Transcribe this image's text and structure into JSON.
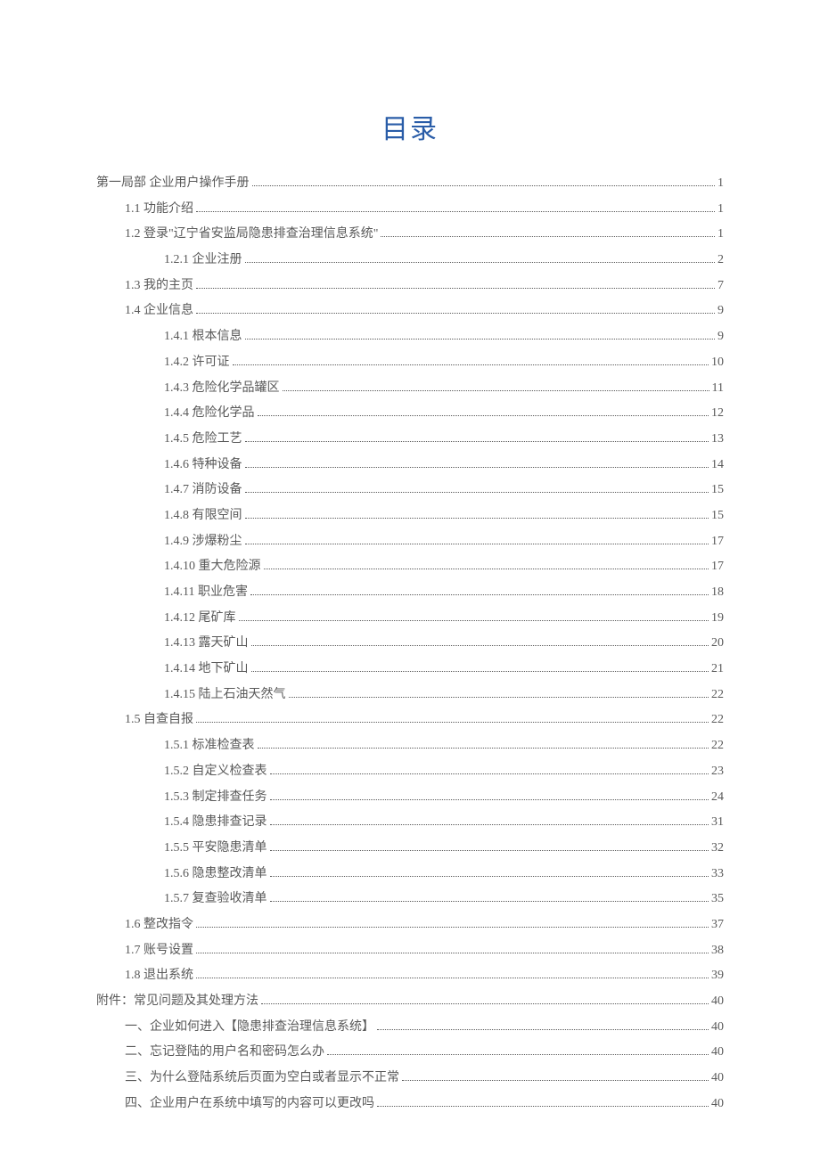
{
  "title": "目录",
  "toc": [
    {
      "level": 0,
      "label": "第一局部 企业用户操作手册",
      "page": "1"
    },
    {
      "level": 1,
      "label": "1.1 功能介绍",
      "page": "1"
    },
    {
      "level": 1,
      "label": "1.2 登录\"辽宁省安监局隐患排查治理信息系统\"",
      "page": "1"
    },
    {
      "level": 2,
      "label": "1.2.1 企业注册",
      "page": "2"
    },
    {
      "level": 1,
      "label": "1.3  我的主页",
      "page": "7"
    },
    {
      "level": 1,
      "label": "1.4 企业信息",
      "page": "9"
    },
    {
      "level": 2,
      "label": "1.4.1 根本信息",
      "page": "9"
    },
    {
      "level": 2,
      "label": "1.4.2 许可证",
      "page": "10"
    },
    {
      "level": 2,
      "label": "1.4.3 危险化学品罐区",
      "page": "11"
    },
    {
      "level": 2,
      "label": "1.4.4 危险化学品",
      "page": "12"
    },
    {
      "level": 2,
      "label": "1.4.5 危险工艺",
      "page": "13"
    },
    {
      "level": 2,
      "label": "1.4.6 特种设备",
      "page": "14"
    },
    {
      "level": 2,
      "label": "1.4.7 消防设备",
      "page": "15"
    },
    {
      "level": 2,
      "label": "1.4.8 有限空间",
      "page": "15"
    },
    {
      "level": 2,
      "label": "1.4.9 涉爆粉尘",
      "page": "17"
    },
    {
      "level": 2,
      "label": "1.4.10 重大危险源",
      "page": "17"
    },
    {
      "level": 2,
      "label": "1.4.11 职业危害",
      "page": "18"
    },
    {
      "level": 2,
      "label": "1.4.12 尾矿库",
      "page": "19"
    },
    {
      "level": 2,
      "label": "1.4.13 露天矿山",
      "page": "20"
    },
    {
      "level": 2,
      "label": "1.4.14 地下矿山",
      "page": "21"
    },
    {
      "level": 2,
      "label": "1.4.15 陆上石油天然气",
      "page": "22"
    },
    {
      "level": 1,
      "label": "1.5 自查自报",
      "page": "22"
    },
    {
      "level": 2,
      "label": "1.5.1 标准检查表",
      "page": "22"
    },
    {
      "level": 2,
      "label": "1.5.2 自定义检查表",
      "page": "23"
    },
    {
      "level": 2,
      "label": "1.5.3 制定排查任务",
      "page": "24"
    },
    {
      "level": 2,
      "label": "1.5.4 隐患排查记录",
      "page": "31"
    },
    {
      "level": 2,
      "label": "1.5.5 平安隐患清单",
      "page": "32"
    },
    {
      "level": 2,
      "label": "1.5.6 隐患整改清单",
      "page": "33"
    },
    {
      "level": 2,
      "label": "1.5.7 复查验收清单",
      "page": "35"
    },
    {
      "level": 1,
      "label": "1.6 整改指令",
      "page": "37"
    },
    {
      "level": 1,
      "label": "1.7 账号设置",
      "page": "38"
    },
    {
      "level": 1,
      "label": "1.8 退出系统",
      "page": "39"
    },
    {
      "level": 0,
      "label": "附件：常见问题及其处理方法",
      "page": "40"
    },
    {
      "level": 1,
      "label": "一、企业如何进入【隐患排查治理信息系统】",
      "page": "40"
    },
    {
      "level": 1,
      "label": "二、忘记登陆的用户名和密码怎么办",
      "page": "40"
    },
    {
      "level": 1,
      "label": "三、为什么登陆系统后页面为空白或者显示不正常",
      "page": "40"
    },
    {
      "level": 1,
      "label": "四、企业用户在系统中填写的内容可以更改吗",
      "page": "40"
    }
  ]
}
